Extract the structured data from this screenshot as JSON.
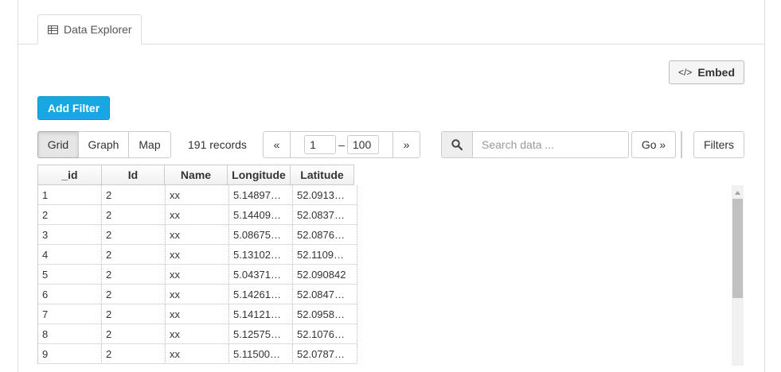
{
  "tabs": {
    "data_explorer_label": "Data Explorer"
  },
  "toolbar": {
    "embed_label": "Embed",
    "add_filter_label": "Add Filter",
    "views": {
      "grid": "Grid",
      "graph": "Graph",
      "map": "Map"
    },
    "record_count": "191 records",
    "pager": {
      "prev": "«",
      "next": "»",
      "from": "1",
      "dash": "–",
      "to": "100"
    },
    "search": {
      "placeholder": "Search data ...",
      "go_label": "Go »"
    },
    "filters_label": "Filters"
  },
  "grid": {
    "columns": [
      "_id",
      "Id",
      "Name",
      "Longitude",
      "Latitude"
    ],
    "rows": [
      [
        "1",
        "2",
        "xx",
        "5.14897…",
        "52.0913…"
      ],
      [
        "2",
        "2",
        "xx",
        "5.14409…",
        "52.0837…"
      ],
      [
        "3",
        "2",
        "xx",
        "5.08675…",
        "52.0876…"
      ],
      [
        "4",
        "2",
        "xx",
        "5.13102…",
        "52.1109…"
      ],
      [
        "5",
        "2",
        "xx",
        "5.04371…",
        "52.090842"
      ],
      [
        "6",
        "2",
        "xx",
        "5.14261…",
        "52.0847…"
      ],
      [
        "7",
        "2",
        "xx",
        "5.14121…",
        "52.0958…"
      ],
      [
        "8",
        "2",
        "xx",
        "5.12575…",
        "52.1076…"
      ],
      [
        "9",
        "2",
        "xx",
        "5.11500…",
        "52.0787…"
      ]
    ]
  },
  "colors": {
    "primary": "#17a8e3",
    "border": "#cccccc"
  }
}
